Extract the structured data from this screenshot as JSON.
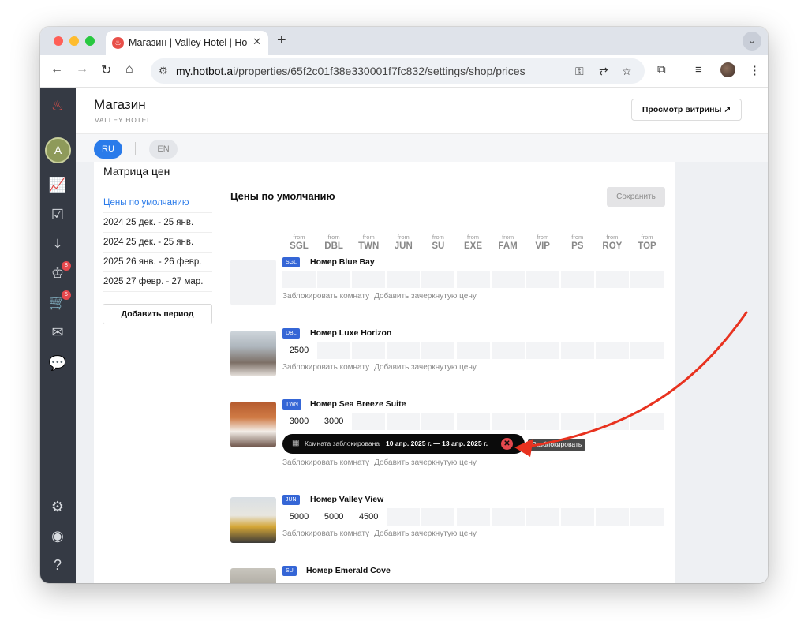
{
  "browser": {
    "tab_title": "Магазин | Valley Hotel | Hotbot",
    "tab_close": "✕",
    "new_tab": "+",
    "tab_menu": "⌄",
    "url_host": "my.hotbot.ai",
    "url_path": "/properties/65f2c01f38e330001f7fc832/settings/shop/prices"
  },
  "sidebar": {
    "avatar_initial": "A",
    "badges": {
      "reviews": "8",
      "cart": "5"
    }
  },
  "header": {
    "title": "Магазин",
    "subtitle": "VALLEY HOTEL",
    "view_button": "Просмотр витрины ↗"
  },
  "languages": {
    "active": "RU",
    "inactive": "EN"
  },
  "matrix": {
    "title": "Матрица цен",
    "periods": [
      "Цены по умолчанию",
      "2024 25 дек. - 25 янв.",
      "2024 25 дек. - 25 янв.",
      "2025 26 янв. - 26 февр.",
      "2025 27 февр. - 27 мар."
    ],
    "add_period": "Добавить период",
    "section_title": "Цены по умолчанию",
    "save_button": "Сохранить",
    "from_label": "from",
    "columns": [
      "SGL",
      "DBL",
      "TWN",
      "JUN",
      "SU",
      "EXE",
      "FAM",
      "VIP",
      "PS",
      "ROY",
      "TOP"
    ]
  },
  "rooms": [
    {
      "code": "SGL",
      "name": "Номер Blue Bay",
      "prices": []
    },
    {
      "code": "DBL",
      "name": "Номер Luxe Horizon",
      "prices": [
        "2500"
      ]
    },
    {
      "code": "TWN",
      "name": "Номер Sea Breeze Suite",
      "prices": [
        "3000",
        "3000"
      ]
    },
    {
      "code": "JUN",
      "name": "Номер Valley View",
      "prices": [
        "5000",
        "5000",
        "4500"
      ]
    },
    {
      "code": "SU",
      "name": "Номер Emerald Cove",
      "prices": []
    }
  ],
  "room_actions": {
    "block": "Заблокировать комнату",
    "strikethrough": "Добавить зачеркнутую цену"
  },
  "blocked": {
    "label": "Комната заблокирована",
    "dates": "10 апр. 2025 г.  —  13 апр. 2025 г.",
    "unblock_tooltip": "Разблокировать",
    "close_glyph": "✕"
  },
  "colors": {
    "accent": "#2a7bea",
    "sidebar": "#353a44",
    "badge": "#e5484d",
    "arrow": "#e8321f"
  }
}
